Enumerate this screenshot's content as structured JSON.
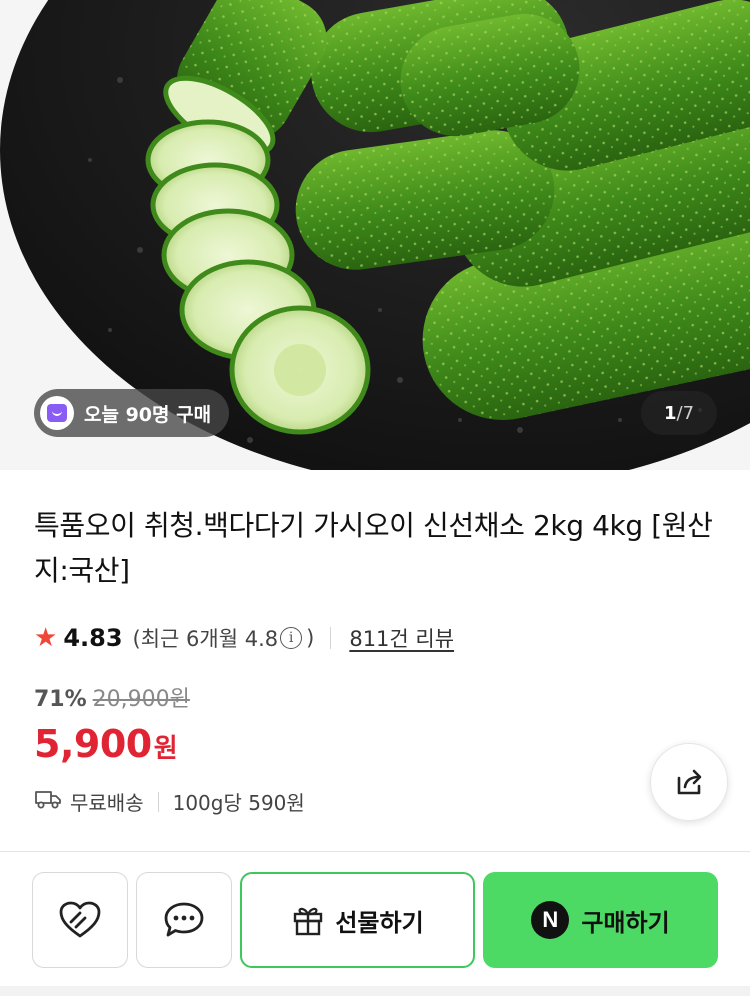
{
  "hero": {
    "badge_text": "오늘 90명 구매",
    "counter_current": "1",
    "counter_sep": "/",
    "counter_total": "7"
  },
  "product": {
    "title": "특품오이 취청.백다다기 가시오이 신선채소 2kg 4kg [원산지:국산]"
  },
  "rating": {
    "score": "4.83",
    "recent_prefix": "(최근 6개월 4.8",
    "recent_suffix": ")",
    "reviews": "811건 리뷰"
  },
  "price": {
    "discount": "71%",
    "original": "20,900원",
    "sale": "5,900",
    "currency": "원"
  },
  "shipping": {
    "label": "무료배송",
    "unit_price": "100g당 590원"
  },
  "actions": {
    "gift_label": "선물하기",
    "buy_label": "구매하기",
    "buy_badge": "N"
  },
  "colors": {
    "sale_red": "#e02434",
    "naver_green": "#4cd964",
    "gift_border": "#3ec75a",
    "star": "#f04638"
  }
}
